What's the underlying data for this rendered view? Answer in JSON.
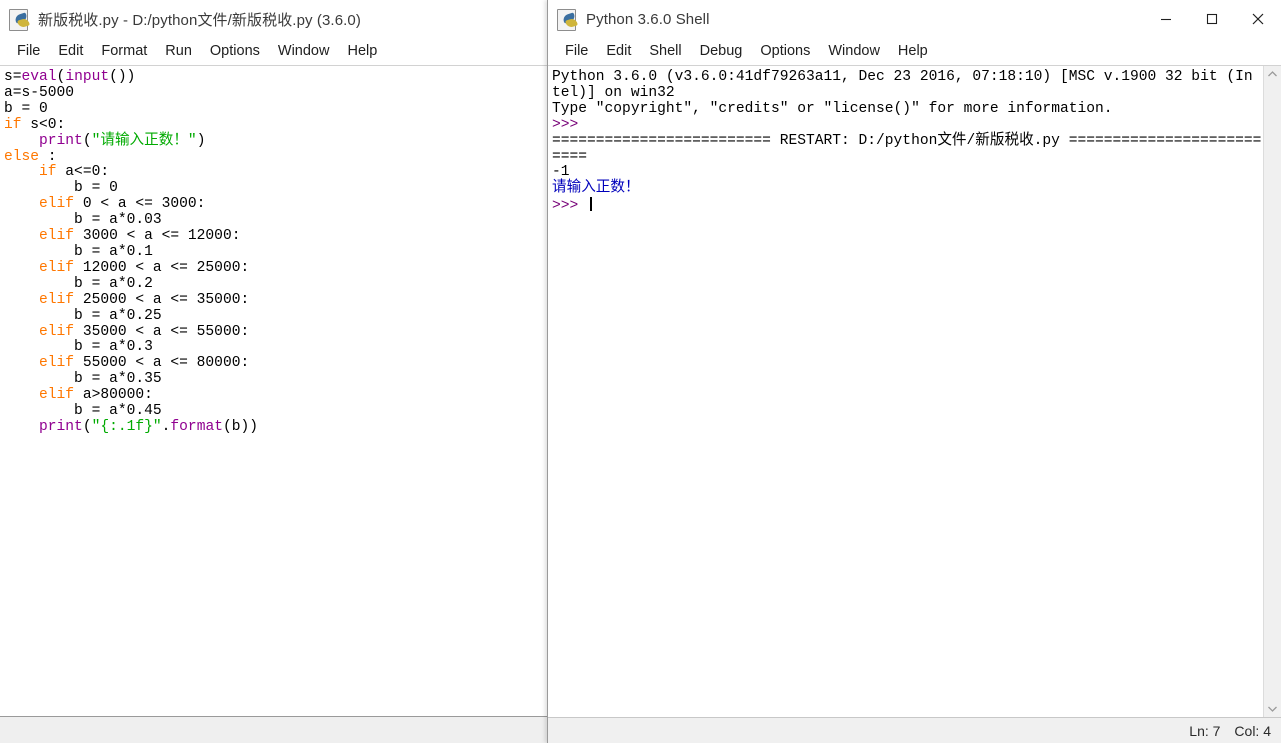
{
  "editor": {
    "title": "新版税收.py - D:/python文件/新版税收.py (3.6.0)",
    "icon": "idle-python-file-icon",
    "menu": [
      "File",
      "Edit",
      "Format",
      "Run",
      "Options",
      "Window",
      "Help"
    ],
    "code_lines": [
      [
        {
          "t": "s=",
          "c": "plain"
        },
        {
          "t": "eval",
          "c": "builtin"
        },
        {
          "t": "(",
          "c": "plain"
        },
        {
          "t": "input",
          "c": "builtin"
        },
        {
          "t": "())",
          "c": "plain"
        }
      ],
      [
        {
          "t": "a=s-5000",
          "c": "plain"
        }
      ],
      [
        {
          "t": "b = 0",
          "c": "plain"
        }
      ],
      [
        {
          "t": "if",
          "c": "kw"
        },
        {
          "t": " s<0:",
          "c": "plain"
        }
      ],
      [
        {
          "t": "    ",
          "c": "plain"
        },
        {
          "t": "print",
          "c": "builtin"
        },
        {
          "t": "(",
          "c": "plain"
        },
        {
          "t": "\"请输入正数！\"",
          "c": "str"
        },
        {
          "t": ")",
          "c": "plain"
        }
      ],
      [
        {
          "t": "else",
          "c": "kw"
        },
        {
          "t": " :",
          "c": "plain"
        }
      ],
      [
        {
          "t": "    ",
          "c": "plain"
        },
        {
          "t": "if",
          "c": "kw"
        },
        {
          "t": " a<=0:",
          "c": "plain"
        }
      ],
      [
        {
          "t": "        b = 0",
          "c": "plain"
        }
      ],
      [
        {
          "t": "    ",
          "c": "plain"
        },
        {
          "t": "elif",
          "c": "kw"
        },
        {
          "t": " 0 < a <= 3000:",
          "c": "plain"
        }
      ],
      [
        {
          "t": "        b = a*0.03",
          "c": "plain"
        }
      ],
      [
        {
          "t": "    ",
          "c": "plain"
        },
        {
          "t": "elif",
          "c": "kw"
        },
        {
          "t": " 3000 < a <= 12000:",
          "c": "plain"
        }
      ],
      [
        {
          "t": "        b = a*0.1",
          "c": "plain"
        }
      ],
      [
        {
          "t": "    ",
          "c": "plain"
        },
        {
          "t": "elif",
          "c": "kw"
        },
        {
          "t": " 12000 < a <= 25000:",
          "c": "plain"
        }
      ],
      [
        {
          "t": "        b = a*0.2",
          "c": "plain"
        }
      ],
      [
        {
          "t": "    ",
          "c": "plain"
        },
        {
          "t": "elif",
          "c": "kw"
        },
        {
          "t": " 25000 < a <= 35000:",
          "c": "plain"
        }
      ],
      [
        {
          "t": "        b = a*0.25",
          "c": "plain"
        }
      ],
      [
        {
          "t": "    ",
          "c": "plain"
        },
        {
          "t": "elif",
          "c": "kw"
        },
        {
          "t": " 35000 < a <= 55000:",
          "c": "plain"
        }
      ],
      [
        {
          "t": "        b = a*0.3",
          "c": "plain"
        }
      ],
      [
        {
          "t": "    ",
          "c": "plain"
        },
        {
          "t": "elif",
          "c": "kw"
        },
        {
          "t": " 55000 < a <= 80000:",
          "c": "plain"
        }
      ],
      [
        {
          "t": "        b = a*0.35",
          "c": "plain"
        }
      ],
      [
        {
          "t": "    ",
          "c": "plain"
        },
        {
          "t": "elif",
          "c": "kw"
        },
        {
          "t": " a>80000:",
          "c": "plain"
        }
      ],
      [
        {
          "t": "        b = a*0.45",
          "c": "plain"
        }
      ],
      [
        {
          "t": "    ",
          "c": "plain"
        },
        {
          "t": "print",
          "c": "builtin"
        },
        {
          "t": "(",
          "c": "plain"
        },
        {
          "t": "\"{:.1f}\"",
          "c": "str"
        },
        {
          "t": ".",
          "c": "plain"
        },
        {
          "t": "format",
          "c": "builtin"
        },
        {
          "t": "(b))",
          "c": "plain"
        }
      ]
    ]
  },
  "shell": {
    "title": "Python 3.6.0 Shell",
    "icon": "idle-python-shell-icon",
    "menu": [
      "File",
      "Edit",
      "Shell",
      "Debug",
      "Options",
      "Window",
      "Help"
    ],
    "controls": {
      "minimize": "minimize-icon",
      "maximize": "maximize-icon",
      "close": "close-icon"
    },
    "output_lines": [
      [
        {
          "t": "Python 3.6.0 (v3.6.0:41df79263a11, Dec 23 2016, 07:18:10) [MSC v.1900 32 bit (In",
          "c": "plain"
        }
      ],
      [
        {
          "t": "tel)] on win32",
          "c": "plain"
        }
      ],
      [
        {
          "t": "Type \"copyright\", \"credits\" or \"license()\" for more information.",
          "c": "plain"
        }
      ],
      [
        {
          "t": ">>>",
          "c": "prompt"
        }
      ],
      [
        {
          "t": "========================= RESTART: D:/python文件/新版税收.py ======================",
          "c": "plain"
        }
      ],
      [
        {
          "t": "====",
          "c": "plain"
        }
      ],
      [
        {
          "t": "-1",
          "c": "plain"
        }
      ],
      [
        {
          "t": "请输入正数！",
          "c": "stdout"
        }
      ],
      [
        {
          "t": ">>> ",
          "c": "prompt"
        }
      ]
    ],
    "scrollbar": {
      "up_arrow": "chevron-up-icon",
      "down_arrow": "chevron-down-icon"
    },
    "status": {
      "line": "Ln: 7",
      "col": "Col: 4"
    }
  }
}
